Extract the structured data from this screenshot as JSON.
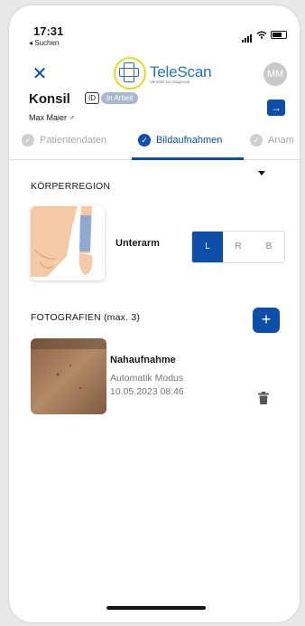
{
  "status_bar": {
    "time": "17:31",
    "back_label": "◂ Suchen"
  },
  "header": {
    "logo_title": "TeleScan",
    "logo_subtitle": "Vernetzt zur Diagnose",
    "avatar_initials": "MM",
    "close_icon": "close-icon",
    "next_icon": "arrow-right-icon"
  },
  "case": {
    "title": "Konsil",
    "id_badge": "ID",
    "status": "In Arbeit",
    "patient": "Max Maier ♂"
  },
  "tabs": [
    {
      "label": "Patientendaten",
      "state": "done"
    },
    {
      "label": "Bildaufnahmen",
      "state": "active"
    },
    {
      "label": "Anam",
      "state": "done"
    }
  ],
  "region": {
    "section_label": "KÖRPERREGION",
    "name": "Unterarm",
    "sides": [
      "L",
      "R",
      "B"
    ],
    "selected_side": "L"
  },
  "photos": {
    "section_label": "FOTOGRAFIEN (max. 3)",
    "add_label": "+",
    "items": [
      {
        "title": "Nahaufnahme",
        "mode": "Automatik Modus",
        "date": "10.05.2023 08:46"
      }
    ]
  },
  "colors": {
    "primary": "#0b4fa8",
    "logo_ring": "#d8df2b",
    "status_badge": "#a9b7cc"
  }
}
